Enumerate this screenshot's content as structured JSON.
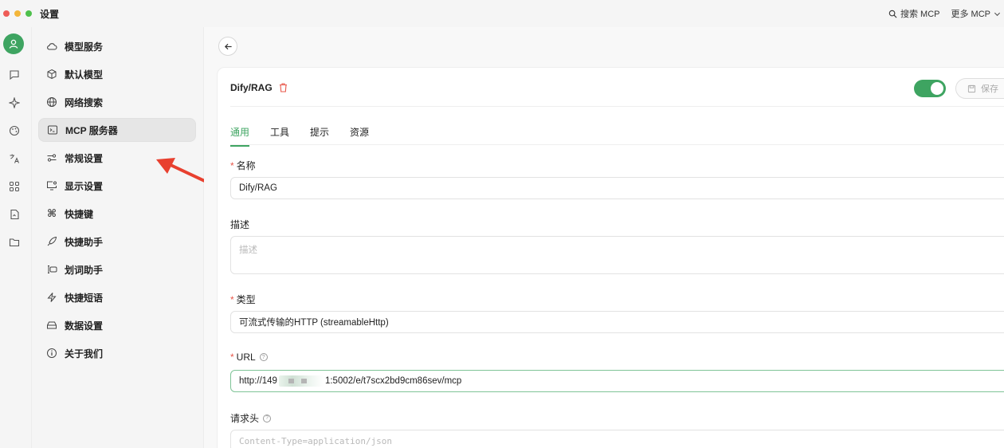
{
  "window": {
    "title": "设置"
  },
  "titlebar": {
    "search_mcp": "搜索 MCP",
    "more_mcp": "更多 MCP"
  },
  "colors": {
    "accent": "#3ea461",
    "danger": "#e8574a",
    "red_dot": "#ee5c57",
    "yellow_dot": "#f3b63a",
    "green_dot": "#4ec04c"
  },
  "rail": {
    "icons": [
      "avatar-icon",
      "chat-icon",
      "sparkle-icon",
      "palette-icon",
      "translate-icon",
      "apps-icon",
      "file-icon",
      "folder-icon"
    ]
  },
  "nav": {
    "items": [
      {
        "label": "模型服务",
        "icon": "cloud-icon"
      },
      {
        "label": "默认模型",
        "icon": "cube-icon"
      },
      {
        "label": "网络搜索",
        "icon": "globe-icon"
      },
      {
        "label": "MCP 服务器",
        "icon": "terminal-icon",
        "active": true
      },
      {
        "label": "常规设置",
        "icon": "settings-sliders-icon"
      },
      {
        "label": "显示设置",
        "icon": "monitor-icon"
      },
      {
        "label": "快捷键",
        "icon": "command-icon"
      },
      {
        "label": "快捷助手",
        "icon": "rocket-icon"
      },
      {
        "label": "划词助手",
        "icon": "text-cursor-icon"
      },
      {
        "label": "快捷短语",
        "icon": "bolt-icon"
      },
      {
        "label": "数据设置",
        "icon": "database-icon"
      },
      {
        "label": "关于我们",
        "icon": "info-icon"
      }
    ]
  },
  "server": {
    "title": "Dify/RAG",
    "enabled": true,
    "save_label": "保存"
  },
  "tabs": [
    "通用",
    "工具",
    "提示",
    "资源"
  ],
  "form": {
    "name_label": "名称",
    "name_value": "Dify/RAG",
    "desc_label": "描述",
    "desc_placeholder": "描述",
    "type_label": "类型",
    "type_value": "可流式传输的HTTP (streamableHttp)",
    "url_label": "URL",
    "url_prefix": "http://149",
    "url_suffix": "1:5002/e/t7scx2bd9cm86sev/mcp",
    "headers_label": "请求头",
    "headers_placeholder": "Content-Type=application/json"
  }
}
